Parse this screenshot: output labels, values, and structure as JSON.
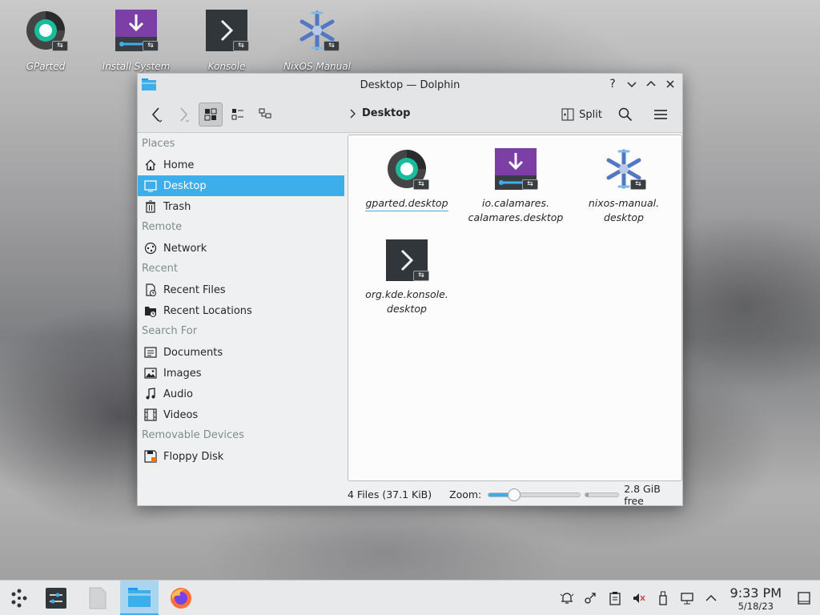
{
  "desktop": {
    "icons": [
      {
        "label": "GParted",
        "icon": "gparted-icon"
      },
      {
        "label": "Install System",
        "icon": "installer-icon"
      },
      {
        "label": "Konsole",
        "icon": "konsole-icon"
      },
      {
        "label": "NixOS Manual",
        "icon": "nixos-icon"
      }
    ]
  },
  "window": {
    "title": "Desktop — Dolphin",
    "buttons": {
      "help": "?",
      "minimize": "⌄",
      "maximize": "⌃",
      "close": "✕"
    }
  },
  "toolbar": {
    "breadcrumb": "Desktop",
    "split_label": "Split"
  },
  "sidebar": {
    "sections": [
      {
        "title": "Places",
        "items": [
          {
            "label": "Home",
            "icon": "home-icon"
          },
          {
            "label": "Desktop",
            "icon": "desktop-icon",
            "selected": true
          },
          {
            "label": "Trash",
            "icon": "trash-icon"
          }
        ]
      },
      {
        "title": "Remote",
        "items": [
          {
            "label": "Network",
            "icon": "network-icon"
          }
        ]
      },
      {
        "title": "Recent",
        "items": [
          {
            "label": "Recent Files",
            "icon": "recent-files-icon"
          },
          {
            "label": "Recent Locations",
            "icon": "recent-locations-icon"
          }
        ]
      },
      {
        "title": "Search For",
        "items": [
          {
            "label": "Documents",
            "icon": "documents-icon"
          },
          {
            "label": "Images",
            "icon": "images-icon"
          },
          {
            "label": "Audio",
            "icon": "audio-icon"
          },
          {
            "label": "Videos",
            "icon": "videos-icon"
          }
        ]
      },
      {
        "title": "Removable Devices",
        "items": [
          {
            "label": "Floppy Disk",
            "icon": "floppy-icon"
          }
        ]
      }
    ]
  },
  "files": [
    {
      "name_line1": "gparted.desktop",
      "name_line2": "",
      "icon": "gparted-icon"
    },
    {
      "name_line1": "io.calamares.",
      "name_line2": "calamares.desktop",
      "icon": "installer-icon"
    },
    {
      "name_line1": "nixos-manual.",
      "name_line2": "desktop",
      "icon": "nixos-icon"
    },
    {
      "name_line1": "org.kde.konsole.",
      "name_line2": "desktop",
      "icon": "konsole-icon"
    }
  ],
  "statusbar": {
    "count": "4 Files (37.1 KiB)",
    "zoom_label": "Zoom:",
    "zoom_level": 0.28,
    "free_space": "2.8 GiB free",
    "used_fraction": 0.1
  },
  "taskbar": {
    "time": "9:33 PM",
    "date": "5/18/23"
  },
  "colors": {
    "accent": "#3daee9",
    "installer_purple": "#7b3fa6",
    "gparted_teal": "#1abc9c",
    "nix_blue": "#5277c3"
  }
}
